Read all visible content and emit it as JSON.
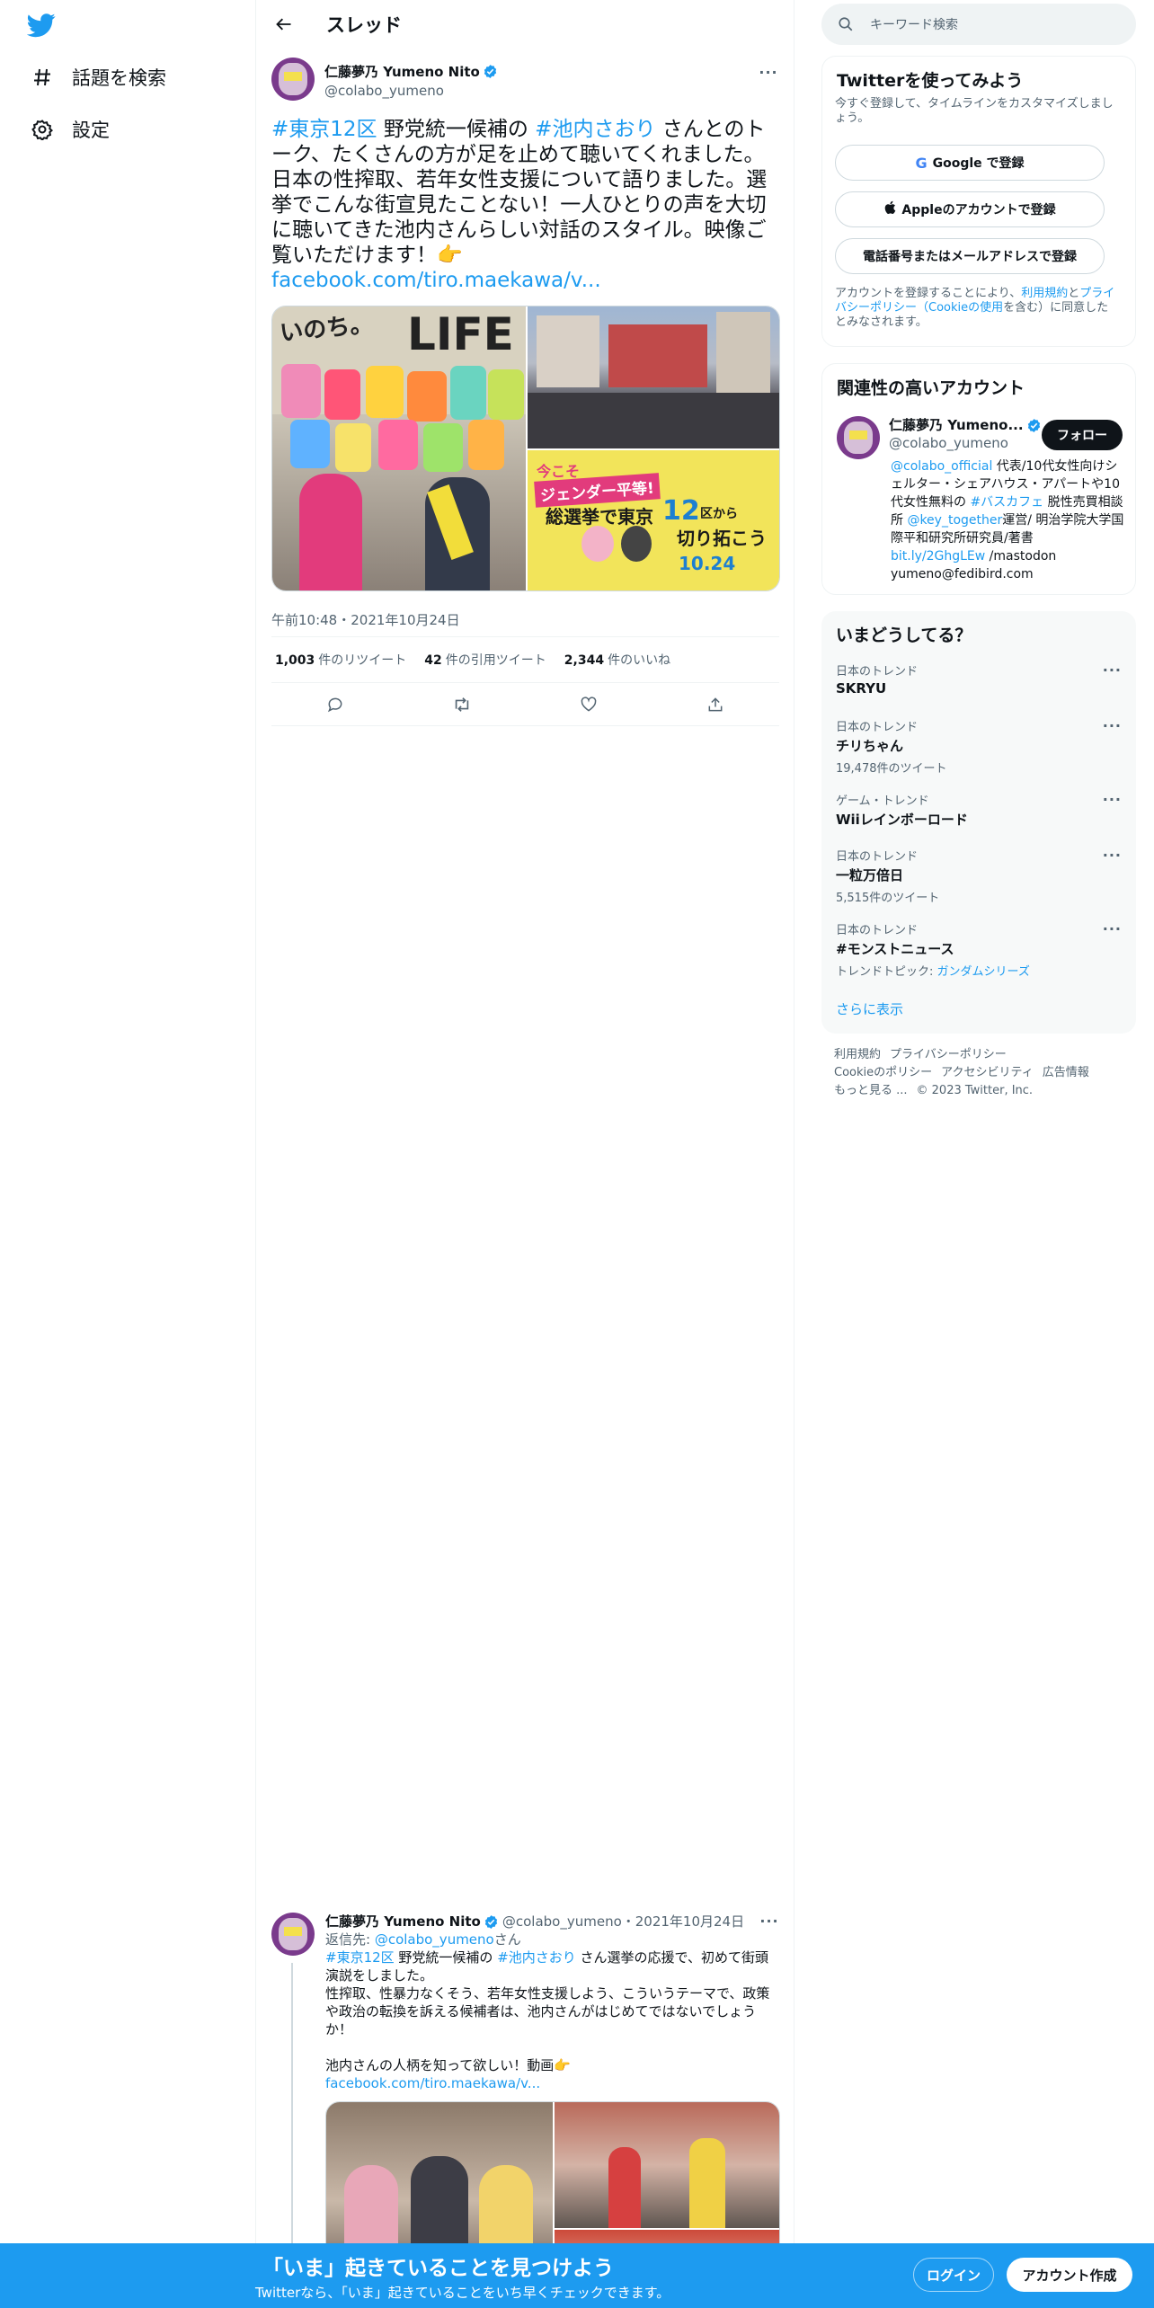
{
  "nav": {
    "explore_label": "話題を検索",
    "settings_label": "設定"
  },
  "header": {
    "title": "スレッド"
  },
  "tweet": {
    "author_name": "仁藤夢乃 Yumeno Nito",
    "author_handle": "@colabo_yumeno",
    "text_parts": {
      "tag1": "#東京12区",
      "t1": " 野党統一候補の ",
      "tag2": "#池内さおり",
      "t2": " さんとのトーク、たくさんの方が足を止めて聴いてくれました。日本の性搾取、若年女性支援について語りました。選挙でこんな街宣見たことない！一人ひとりの声を大切に聴いてきた池内さんらしい対話のスタイル。映像ご覧いただけます！👉",
      "link": "facebook.com/tiro.maekawa/v..."
    },
    "media_texts": {
      "life": "LIFE",
      "inochi": "いのち。",
      "now": "今こそ",
      "gender": "ジェンダー平等!",
      "election": "総選挙で東京",
      "ward": "12",
      "ku": "区から",
      "kiri": "切り拓こう",
      "date": "10.24"
    },
    "timestamp": "午前10:48・2021年10月24日",
    "stats": {
      "retweets": "1,003",
      "retweets_label": "件のリツイート",
      "quotes": "42",
      "quotes_label": "件の引用ツイート",
      "likes": "2,344",
      "likes_label": "件のいいね"
    }
  },
  "reply": {
    "author_name": "仁藤夢乃 Yumeno Nito",
    "meta": "@colabo_yumeno・2021年10月24日",
    "replyto_prefix": "返信先: ",
    "replyto_handle": "@colabo_yumeno",
    "replyto_suffix": "さん",
    "tag1": "#東京12区",
    "t1": " 野党統一候補の ",
    "tag2": "#池内さおり",
    "t2": " さん選挙の応援で、初めて街頭演説をしました。\n性搾取、性暴力なくそう、若年女性支援しよう、こういうテーマで、政策や政治の転換を訴える候補者は、池内さんがはじめてではないでしょうか！\n\n池内さんの人柄を知って欲しい！動画👉",
    "link": "facebook.com/tiro.maekawa/v..."
  },
  "sidebar": {
    "search_placeholder": "キーワード検索",
    "signup": {
      "title": "Twitterを使ってみよう",
      "subtitle": "今すぐ登録して、タイムラインをカスタマイズしましょう。",
      "google": "Google で登録",
      "apple": "Appleのアカウントで登録",
      "phone": "電話番号またはメールアドレスで登録",
      "legal_a": "アカウントを登録することにより、",
      "legal_link1": "利用規約",
      "legal_b": "と",
      "legal_link2": "プライバシーポリシー（Cookieの使用",
      "legal_c": "を含む）に同意したとみなされます。"
    },
    "related": {
      "title": "関連性の高いアカウント",
      "name": "仁藤夢乃 Yumeno...",
      "handle": "@colabo_yumeno",
      "follow": "フォロー",
      "bio_link1": "@colabo_official",
      "bio_1": " 代表/10代女性向けシェルター・シェアハウス・アパートや10代女性無料の ",
      "bio_link2": "#バスカフェ",
      "bio_2": " 脱性売買相談所 ",
      "bio_link3": "@key_together",
      "bio_3": "運営/ 明治学院大学国際平和研究所研究員/著書",
      "bio_link4": "bit.ly/2GhgLEw",
      "bio_4": " /mastodon yumeno@fedibird.com"
    },
    "trends": {
      "title": "いまどうしてる？",
      "items": [
        {
          "context": "日本のトレンド",
          "name": "SKRYU",
          "count": ""
        },
        {
          "context": "日本のトレンド",
          "name": "チリちゃん",
          "count": "19,478件のツイート"
        },
        {
          "context": "ゲーム・トレンド",
          "name": "Wiiレインボーロード",
          "count": ""
        },
        {
          "context": "日本のトレンド",
          "name": "一粒万倍日",
          "count": "5,515件のツイート"
        },
        {
          "context": "日本のトレンド",
          "name": "#モンストニュース",
          "count_prefix": "トレンドトピック: ",
          "count_link": "ガンダムシリーズ"
        }
      ],
      "show_more": "さらに表示"
    },
    "footer": {
      "terms": "利用規約",
      "privacy": "プライバシーポリシー",
      "cookies": "Cookieのポリシー",
      "accessibility": "アクセシビリティ",
      "ads": "広告情報",
      "more": "もっと見る ...",
      "copyright": "© 2023 Twitter, Inc."
    }
  },
  "bottom": {
    "headline": "「いま」起きていることを見つけよう",
    "sub": "Twitterなら、「いま」起きていることをいち早くチェックできます。",
    "login": "ログイン",
    "signup": "アカウント作成"
  },
  "colors": {
    "accent": "#1d9bf0",
    "text": "#0f1419",
    "muted": "#536471"
  }
}
